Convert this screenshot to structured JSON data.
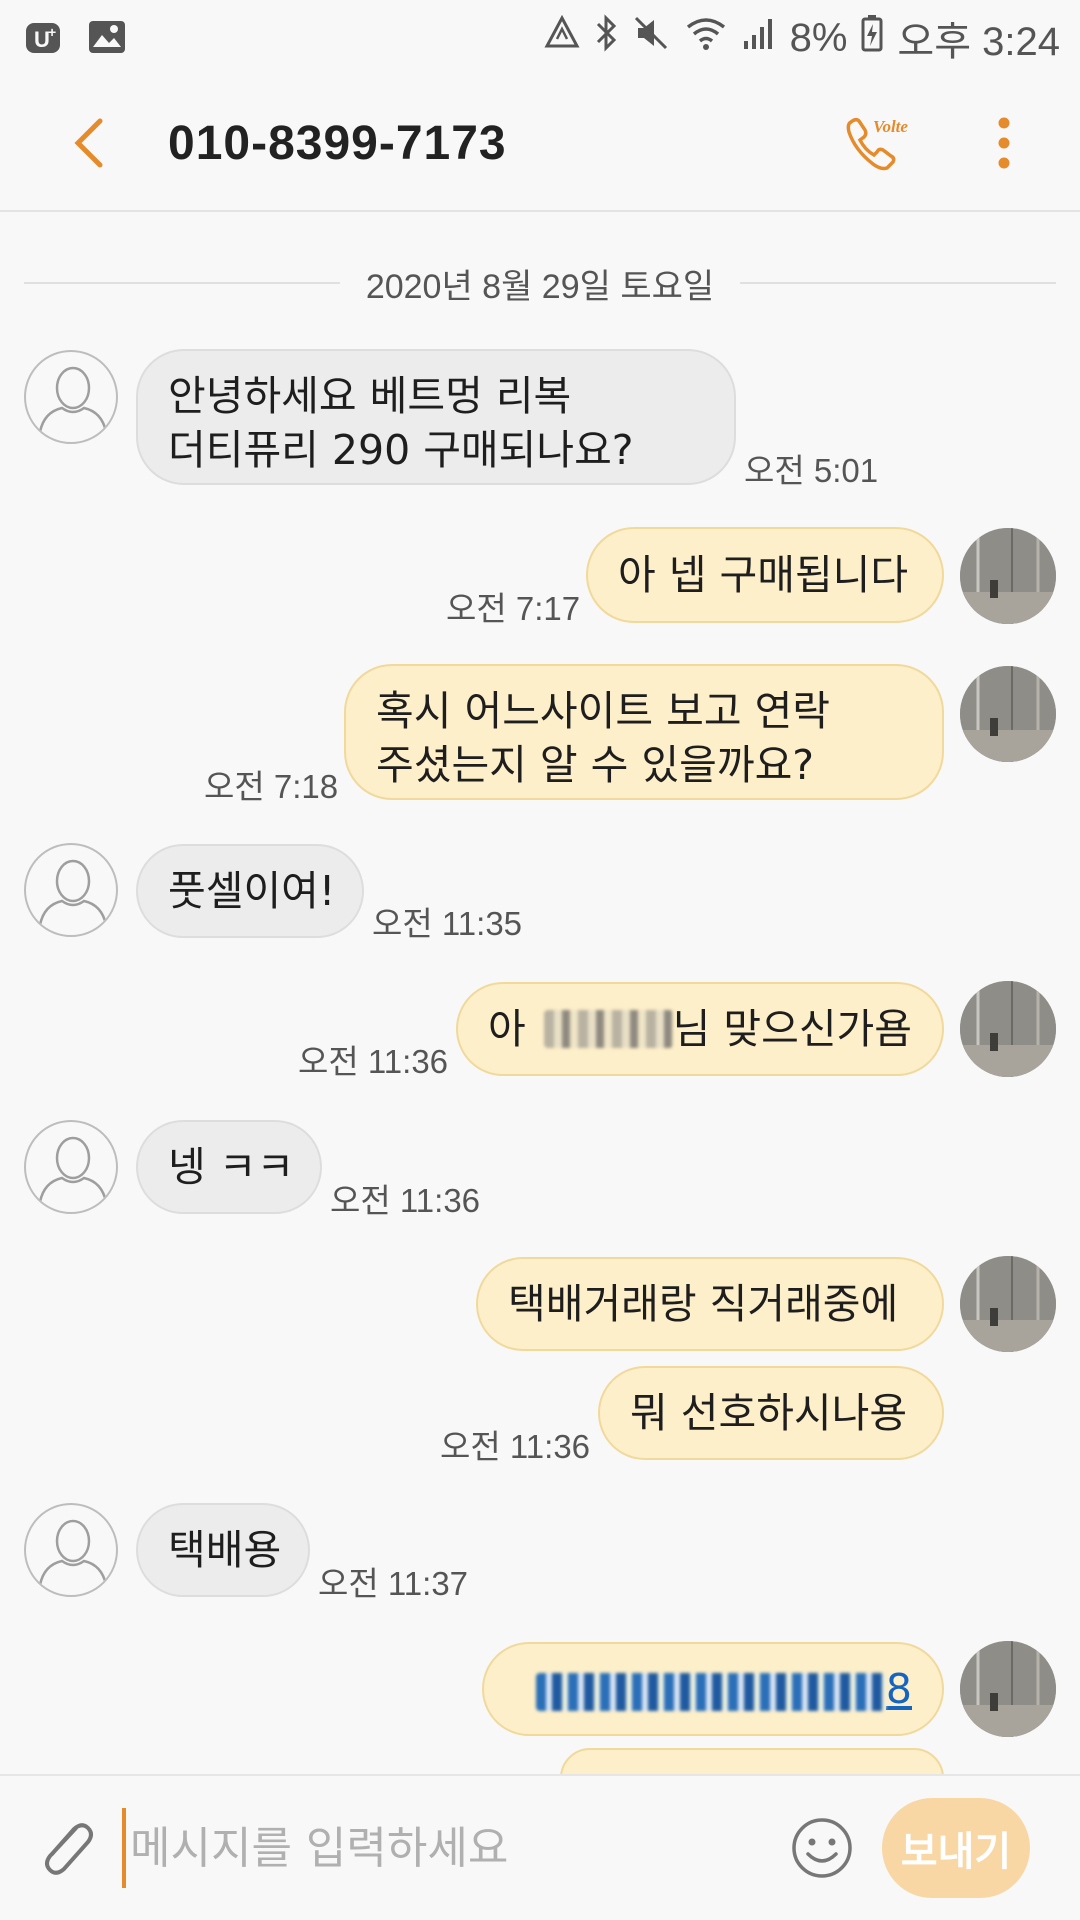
{
  "status_bar": {
    "battery": "8%",
    "time": "오후 3:24"
  },
  "header": {
    "title": "010-8399-7173",
    "call_badge": "Volte"
  },
  "date_divider": "2020년 8월 29일 토요일",
  "messages": [
    {
      "direction": "incoming",
      "lines": [
        "안녕하세요 베트멍 리복",
        "더티퓨리 290 구매되나요?"
      ],
      "time": "오전 5:01"
    },
    {
      "direction": "outgoing",
      "text": "아 넵 구매됩니다",
      "time": "오전 7:17"
    },
    {
      "direction": "outgoing",
      "lines": [
        "혹시 어느사이트 보고 연락",
        "주셨는지 알 수 있을까요?"
      ],
      "time": "오전 7:18"
    },
    {
      "direction": "incoming",
      "text": "풋셀이여!",
      "time": "오전 11:35"
    },
    {
      "direction": "outgoing",
      "text_prefix": "아",
      "text_suffix": "님 맞으신가욤",
      "time": "오전 11:36"
    },
    {
      "direction": "incoming",
      "text": "넹 ㅋㅋ",
      "time": "오전 11:36"
    },
    {
      "direction": "outgoing",
      "text": "택배거래랑 직거래중에"
    },
    {
      "direction": "outgoing",
      "text": "뭐 선호하시나용",
      "time": "오전 11:36"
    },
    {
      "direction": "incoming",
      "text": "택배용",
      "time": "오전 11:37"
    },
    {
      "direction": "outgoing",
      "text_suffix": "8",
      "link": true
    }
  ],
  "composer": {
    "placeholder": "메시지를 입력하세요",
    "send_label": "보내기"
  },
  "colors": {
    "accent": "#e58b2c",
    "incoming_bubble": "#ececec",
    "outgoing_bubble": "#fdefc9",
    "send_button": "#f9d7a4"
  }
}
